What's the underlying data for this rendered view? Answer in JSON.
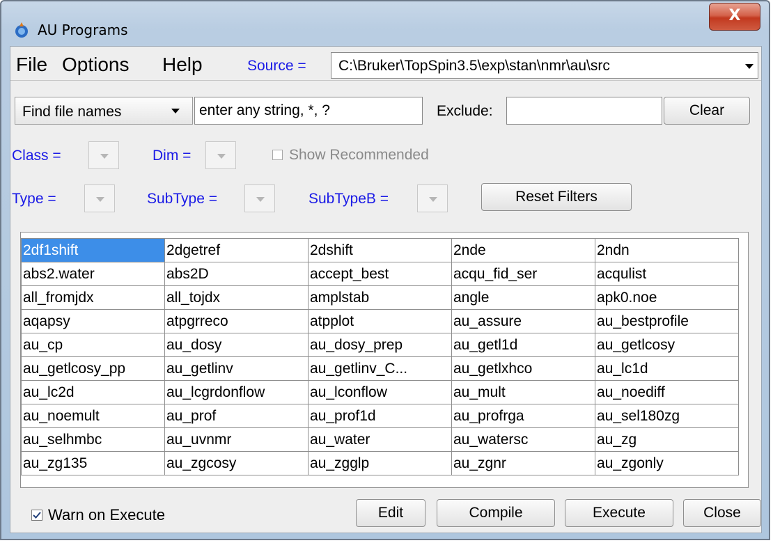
{
  "window": {
    "title": "AU Programs",
    "close_glyph": "X",
    "icon": "app-icon"
  },
  "menubar": {
    "file": "File",
    "options": "Options",
    "help": "Help"
  },
  "source": {
    "label": "Source =",
    "value": "C:\\Bruker\\TopSpin3.5\\exp\\stan\\nmr\\au\\src"
  },
  "search": {
    "mode": "Find file names",
    "placeholder": "enter any string, *, ?",
    "exclude_label": "Exclude:",
    "exclude_value": "",
    "clear": "Clear"
  },
  "filters": {
    "class_label": "Class =",
    "dim_label": "Dim =",
    "show_recommended": "Show Recommended",
    "show_recommended_checked": false,
    "type_label": "Type =",
    "subtype_label": "SubType =",
    "subtypeb_label": "SubTypeB =",
    "reset": "Reset Filters"
  },
  "grid": {
    "selected": "2df1shift",
    "rows": [
      [
        "2df1shift",
        "2dgetref",
        "2dshift",
        "2nde",
        "2ndn"
      ],
      [
        "abs2.water",
        "abs2D",
        "accept_best",
        "acqu_fid_ser",
        "acqulist"
      ],
      [
        "all_fromjdx",
        "all_tojdx",
        "amplstab",
        "angle",
        "apk0.noe"
      ],
      [
        "aqapsy",
        "atpgrreco",
        "atpplot",
        "au_assure",
        "au_bestprofile"
      ],
      [
        "au_cp",
        "au_dosy",
        "au_dosy_prep",
        "au_getl1d",
        "au_getlcosy"
      ],
      [
        "au_getlcosy_pp",
        "au_getlinv",
        "au_getlinv_C...",
        "au_getlxhco",
        "au_lc1d"
      ],
      [
        "au_lc2d",
        "au_lcgrdonflow",
        "au_lconflow",
        "au_mult",
        "au_noediff"
      ],
      [
        "au_noemult",
        "au_prof",
        "au_prof1d",
        "au_profrga",
        "au_sel180zg"
      ],
      [
        "au_selhmbc",
        "au_uvnmr",
        "au_water",
        "au_watersc",
        "au_zg"
      ],
      [
        "au_zg135",
        "au_zgcosy",
        "au_zgglp",
        "au_zgnr",
        "au_zgonly"
      ]
    ]
  },
  "footer": {
    "warn_label": "Warn on Execute",
    "warn_checked": true,
    "edit": "Edit",
    "compile": "Compile",
    "execute": "Execute",
    "close": "Close"
  },
  "colors": {
    "label_blue": "#1a1ae6",
    "selection": "#3d8ee8",
    "close_red": "#c2391f"
  }
}
